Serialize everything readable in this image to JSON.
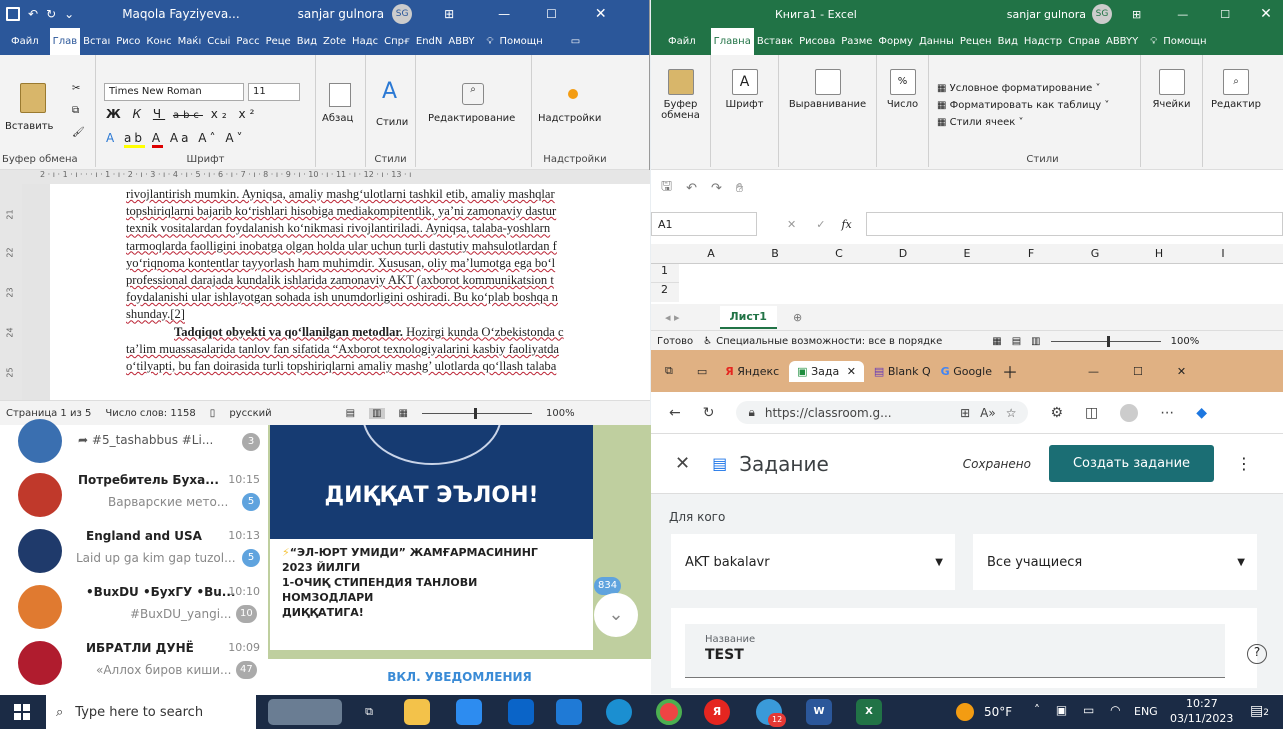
{
  "word": {
    "doc_name": "Maqola Fayziyeva...",
    "user": "sanjar gulnora",
    "user_initials": "SG",
    "tabs": [
      "Файл",
      "Глав",
      "Встаı",
      "Рисо",
      "Конс",
      "Маќı",
      "Ссыі",
      "Расс",
      "Реце",
      "Вид",
      "Zote",
      "Надс",
      "Спрғ",
      "EndN",
      "ABBY"
    ],
    "help": "Помощн",
    "groups": {
      "clipboard": "Буфер обмена",
      "font": "Шрифт",
      "styles": "Стили",
      "addins": "Надстройки"
    },
    "paste": "Вставить",
    "font_name": "Times New Roman",
    "font_size": "11",
    "paragraph": "Абзац",
    "styles_btn": "Стили",
    "editing": "Редактирование",
    "addins_btn": "Надстройки",
    "ruler": "2 · ı · 1 · ı · ·   · ı · 1 · ı · 2 · ı · 3 · ı · 4 · ı · 5 · ı · 6 · ı · 7 · ı · 8 · ı · 9 · ı · 10 · ı · 11 · ı · 12 · ı · 13 · ı",
    "vruler": [
      "21",
      "22",
      "23",
      "24",
      "25"
    ],
    "lines": [
      "rivojlantirish mumkin. Ayniqsa, amaliy mashg‘ulotlarni tashkil etib, amaliy mashqlar",
      "topshiriqlarni bajarib ko‘rishlari hisobiga mediakompitentlik, ya’ni zamonaviy dastur",
      "texnik vositalardan foydalanish ko‘nikmasi rivojlantiriladi.  Ayniqsa, talaba-yoshlarn",
      "tarmoqlarda faolligini inobatga olgan holda ular uchun turli dastutiy mahsulotlardan f",
      "yo‘riqnoma kontentlar tayyorlash ham muhimdir. Xususan, oliy  ma’lumotga ega bo‘l",
      "professional darajada kundalik ishlarida zamonaviy AKT (axborot kommunikatsion t",
      "foydalanishi ular ishlayotgan sohada ish unumdorligini oshiradi. Bu ko‘plab boshqa n",
      "shunday.[2]"
    ],
    "heading_bold": "Tadqiqot obyekti va qo‘llanilgan metodlar.",
    "heading_rest": " Hozirgi kunda O‘zbekistonda c",
    "lines2": [
      "ta’lim muassasalarida tanlov fan sifatida “Axborot texnologiyalarini kasbiy faoliyatda",
      "o‘tilyapti, bu fan doirasida turli topshiriqlarni amaliy mashg’ ulotlarda qo‘llash talaba"
    ],
    "status": {
      "page": "Страница 1 из 5",
      "words": "Число слов: 1158",
      "lang": "русский",
      "zoom": "100%"
    }
  },
  "excel": {
    "title": "Книга1  -  Excel",
    "user": "sanjar gulnora",
    "user_initials": "SG",
    "tabs": [
      "Файл",
      "Главна",
      "Вставк",
      "Рисова",
      "Разме",
      "Форму",
      "Данны",
      "Рецен",
      "Вид",
      "Надстр",
      "Справ",
      "ABBYY"
    ],
    "help": "Помощн",
    "clipboard": "Буфер обмена",
    "font": "Шрифт",
    "align": "Выравнивание",
    "number": "Число",
    "cond_format": "Условное форматирование",
    "format_table": "Форматировать как таблицу",
    "cell_styles": "Стили ячеек",
    "styles_group": "Стили",
    "cells": "Ячейки",
    "editing": "Редактир",
    "namebox": "A1",
    "fx": "fx",
    "columns": [
      "A",
      "B",
      "C",
      "D",
      "E",
      "F",
      "G",
      "H",
      "I"
    ],
    "rows": [
      "1",
      "2"
    ],
    "sheet": "Лист1",
    "status_ready": "Готово",
    "status_access": "Специальные возможности: все в порядке",
    "zoom": "100%"
  },
  "edge": {
    "tabs": [
      "Яндекс",
      "Зада",
      "Blank Q",
      "Google"
    ],
    "url": "https://classroom.g...",
    "header_title": "Задание",
    "saved": "Сохранено",
    "create_btn": "Создать задание",
    "for_whom": "Для кого",
    "class_select": "AKT bakalavr",
    "students_select": "Все учащиеся",
    "title_label": "Название",
    "title_value": "TEST"
  },
  "telegram": {
    "chats": [
      {
        "name": "#5_tashabbus #Li...",
        "time": "",
        "preview": "",
        "badge": "3",
        "color": "#3a6fb0"
      },
      {
        "name": "Потребитель Буха...",
        "time": "10:15",
        "preview": "Варварские мето...",
        "badge": "5",
        "color": "#c0392b"
      },
      {
        "name": "England and USA",
        "time": "10:13",
        "preview": "Laid up ga kim gap tuzol...",
        "badge": "5",
        "color": "#1f3a6b"
      },
      {
        "name": "•BuxDU •БухГУ •Bu...",
        "time": "10:10",
        "preview": "#BuxDU_yangi...",
        "badge": "10",
        "color": "#e07a30"
      },
      {
        "name": "ИБРАТЛИ ДУНЁ",
        "time": "10:09",
        "preview": "«Аллох биров киши...",
        "badge": "47",
        "color": "#b01c2e"
      }
    ],
    "post_banner": "ДИҚҚАТ ЭЪЛОН!",
    "post_text": [
      "“ЭЛ-ЮРТ УМИДИ” ЖАМҒАРМАСИНИНГ",
      "2023 ЙИЛГИ",
      "1-ОЧИҚ СТИПЕНДИЯ ТАНЛОВИ",
      "НОМЗОДЛАРИ",
      "ДИҚҚАТИГА!"
    ],
    "unread": "834",
    "notify_btn": "ВКЛ. УВЕДОМЛЕНИЯ"
  },
  "taskbar": {
    "search": "Type here to search",
    "weather": "50°F",
    "lang": "ENG",
    "time": "10:27",
    "date": "03/11/2023",
    "notif": "2",
    "tg_badge": "12"
  }
}
